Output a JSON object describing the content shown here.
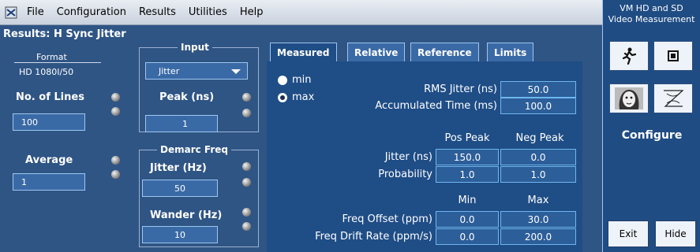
{
  "menu": {
    "items": [
      "File",
      "Configuration",
      "Results",
      "Utilities",
      "Help"
    ]
  },
  "results": {
    "title": "Results: H Sync Jitter",
    "format_label": "Format",
    "format_value": "HD 1080I/50",
    "lines_label": "No. of Lines",
    "lines_value": "100",
    "average_label": "Average",
    "average_value": "1"
  },
  "input": {
    "title": "Input",
    "dropdown_value": "Jitter",
    "peak_label": "Peak (ns)",
    "peak_value": "1"
  },
  "demarc": {
    "title": "Demarc Freq",
    "jitter_label": "Jitter (Hz)",
    "jitter_value": "50",
    "wander_label": "Wander (Hz)",
    "wander_value": "10"
  },
  "tabs": [
    {
      "label": "Measured",
      "active": true
    },
    {
      "label": "Relative",
      "active": false
    },
    {
      "label": "Reference",
      "active": false
    },
    {
      "label": "Limits",
      "active": false
    }
  ],
  "measured": {
    "radio_min": "min",
    "radio_max": "max",
    "rms_label": "RMS Jitter (ns)",
    "rms_value": "50.0",
    "acc_label": "Accumulated Time (ms)",
    "acc_value": "100.0",
    "pos_peak_hdr": "Pos Peak",
    "neg_peak_hdr": "Neg Peak",
    "jitter_row_label": "Jitter (ns)",
    "jitter_pos": "150.0",
    "jitter_neg": "0.0",
    "prob_label": "Probability",
    "prob_pos": "1.0",
    "prob_neg": "1.0",
    "min_hdr": "Min",
    "max_hdr": "Max",
    "freq_offset_label": "Freq Offset (ppm)",
    "freq_offset_min": "0.0",
    "freq_offset_max": "30.0",
    "freq_drift_label": "Freq Drift Rate (ppm/s)",
    "freq_drift_min": "0.0",
    "freq_drift_max": "200.0"
  },
  "right": {
    "title_line1": "VM HD and SD",
    "title_line2": "Video Measurement",
    "configure": "Configure",
    "exit": "Exit",
    "hide": "Hide"
  }
}
